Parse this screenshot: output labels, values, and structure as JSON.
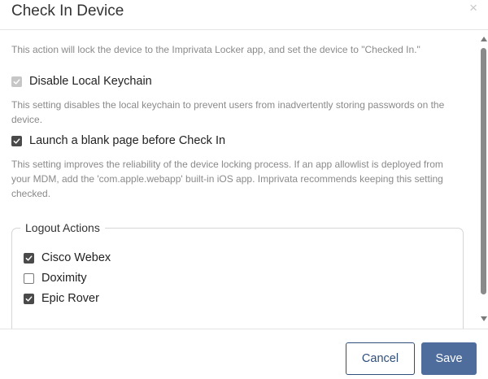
{
  "dialog": {
    "title": "Check In Device",
    "close_label": "×",
    "intro_text": "This action will lock the device to the Imprivata Locker app, and set the device to \"Checked In.\""
  },
  "options": [
    {
      "label": "Disable Local Keychain",
      "checked": true,
      "disabled": true,
      "description": "This setting disables the local keychain to prevent users from inadvertently storing passwords on the device."
    },
    {
      "label": "Launch a blank page before Check In",
      "checked": true,
      "disabled": false,
      "description": "This setting improves the reliability of the device locking process. If an app allowlist is deployed from your MDM, add the 'com.apple.webapp' built-in iOS app. Imprivata recommends keeping this setting checked."
    }
  ],
  "logout_actions": {
    "legend": "Logout Actions",
    "items": [
      {
        "label": "Cisco Webex",
        "checked": true
      },
      {
        "label": "Doximity",
        "checked": false
      },
      {
        "label": "Epic Rover",
        "checked": true
      }
    ]
  },
  "footer": {
    "cancel_label": "Cancel",
    "save_label": "Save"
  },
  "colors": {
    "primary": "#4f6d9c",
    "primary_border": "#2f4f7a",
    "muted_text": "#8a8a8a",
    "checkbox_checked": "#4a4a4a",
    "checkbox_disabled": "#c6c6c6"
  },
  "icons": {
    "close": "close-icon",
    "check": "check-icon",
    "scroll_up": "scroll-up-arrow-icon",
    "scroll_down": "scroll-down-arrow-icon"
  }
}
